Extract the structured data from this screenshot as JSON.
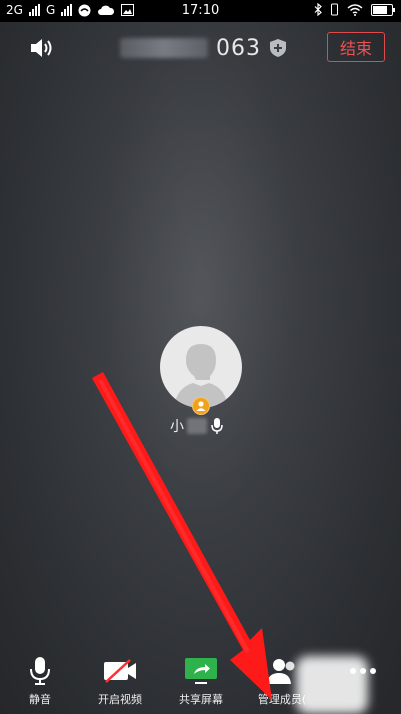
{
  "status_bar": {
    "network_left": "2G",
    "network_right": "G",
    "time": "17:10"
  },
  "header": {
    "meeting_id_visible": "063",
    "end_label": "结束"
  },
  "participant": {
    "name_visible": "小"
  },
  "toolbar": {
    "items": [
      {
        "label": "静音",
        "icon": "microphone-icon"
      },
      {
        "label": "开启视频",
        "icon": "video-off-icon"
      },
      {
        "label": "共享屏幕",
        "icon": "share-screen-icon"
      },
      {
        "label": "管理成员(",
        "icon": "members-icon"
      }
    ]
  },
  "colors": {
    "end_red": "#f05050",
    "share_green": "#2fb24b",
    "host_badge": "#f0a21a",
    "annotation_arrow": "#ff1a1a"
  }
}
